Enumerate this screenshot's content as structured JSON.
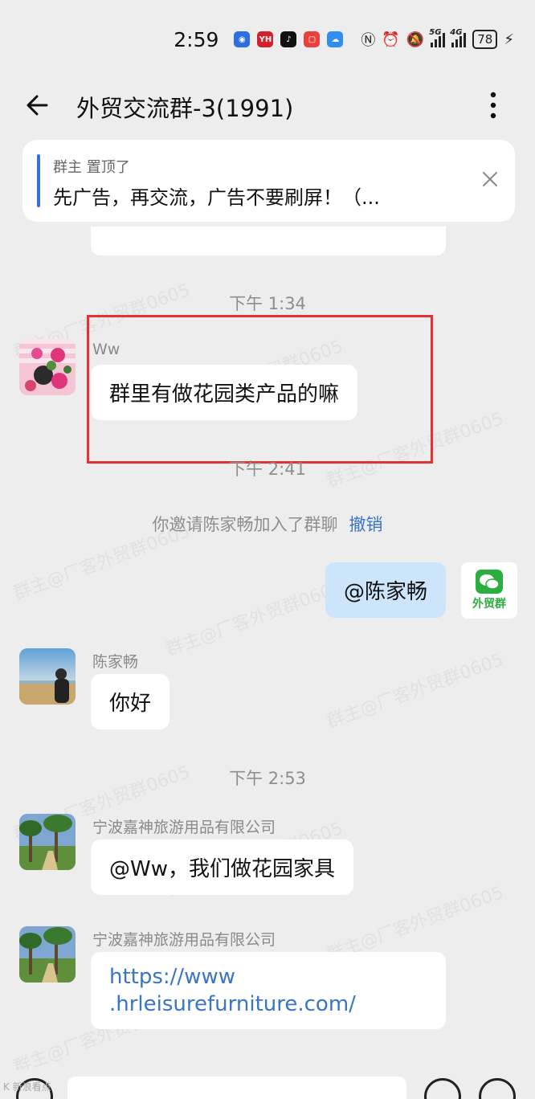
{
  "status_bar": {
    "time": "2:59",
    "battery": "78",
    "network_1": "5G",
    "network_2": "4G",
    "app_icons": [
      {
        "name": "blue-circle-app-icon",
        "color": "#2c6fe0",
        "glyph": "◉"
      },
      {
        "name": "yh-app-icon",
        "color": "#d4202c",
        "glyph": "YH"
      },
      {
        "name": "tiktok-app-icon",
        "color": "#111111",
        "glyph": "♪"
      },
      {
        "name": "red-square-app-icon",
        "color": "#e8413c",
        "glyph": "▢"
      },
      {
        "name": "weather-app-icon",
        "color": "#2e8ff0",
        "glyph": "☁"
      }
    ],
    "system_icons": [
      "nfc-icon",
      "alarm-icon",
      "mute-icon"
    ]
  },
  "header": {
    "title": "外贸交流群-3(1991)"
  },
  "pinned": {
    "meta": "群主 置顶了",
    "text": "先广告，再交流，广告不要刷屏！（..."
  },
  "messages": {
    "time_1": "下午 1:34",
    "ww_sender": "Ww",
    "ww_text": "群里有做花园类产品的嘛",
    "time_2": "下午 2:41",
    "invite_note": "你邀请陈家畅加入了群聊",
    "invite_action": "撤销",
    "self_text": "@陈家畅",
    "self_avatar_label": "外贸群",
    "chen_sender": "陈家畅",
    "chen_text": "你好",
    "time_3": "下午 2:53",
    "nb_sender_1": "宁波嘉神旅游用品有限公司",
    "nb_text_1": "@Ww，我们做花园家具",
    "nb_sender_2": "宁波嘉神旅游用品有限公司",
    "nb_link_line1": "https://www",
    "nb_link_line2": ".hrleisurefurniture.com/"
  },
  "watermark_text": "群主@厂客外贸群0605",
  "corner_mark": "K 新浪看点",
  "colors": {
    "accent": "#2f74d6",
    "link": "#3a74c7",
    "self_bubble": "#cde5fb",
    "highlight": "#e43232",
    "background": "#ededed"
  }
}
